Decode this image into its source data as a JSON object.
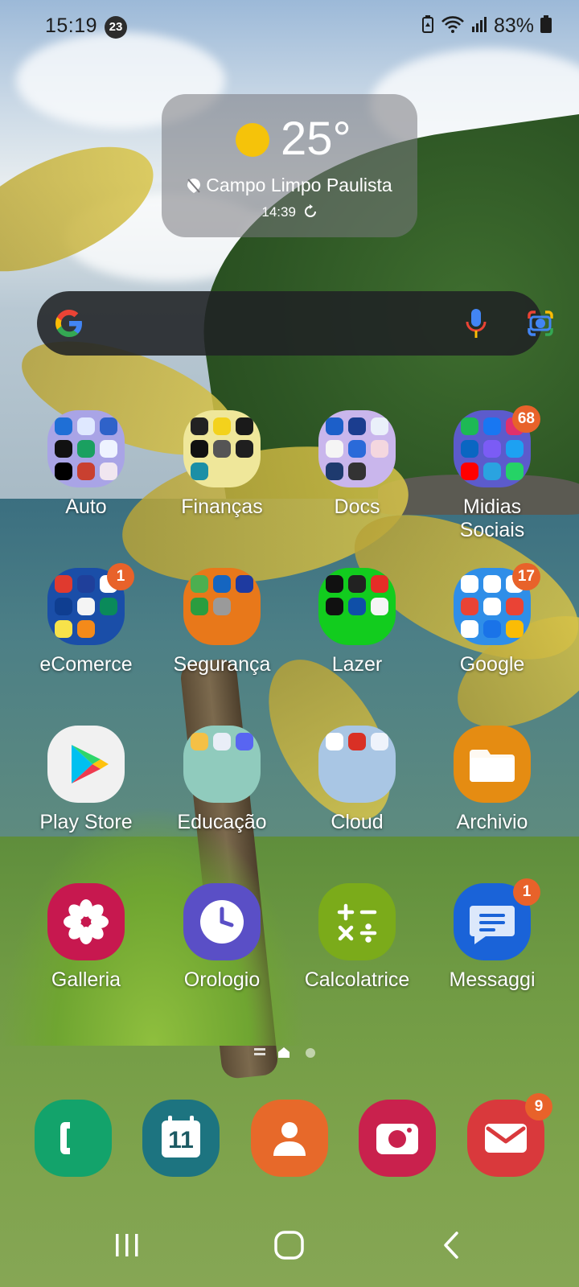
{
  "status_bar": {
    "time": "15:19",
    "notification_count": "23",
    "battery_percent": "83%",
    "icons": [
      "recycle-battery-icon",
      "wifi-icon",
      "signal-icon",
      "battery-icon"
    ]
  },
  "weather": {
    "temperature": "25°",
    "location": "Campo Limpo Paulista",
    "updated_time": "14:39",
    "condition_icon": "sun-icon"
  },
  "search": {
    "icons": [
      "google-logo",
      "mic-icon",
      "lens-icon"
    ]
  },
  "apps": [
    {
      "label": "Auto",
      "kind": "folder",
      "badge": ""
    },
    {
      "label": "Finanças",
      "kind": "folder",
      "badge": ""
    },
    {
      "label": "Docs",
      "kind": "folder",
      "badge": ""
    },
    {
      "label": "Midias\nSociais",
      "kind": "folder",
      "badge": "68"
    },
    {
      "label": "eComerce",
      "kind": "folder",
      "badge": "1"
    },
    {
      "label": "Segurança",
      "kind": "folder",
      "badge": ""
    },
    {
      "label": "Lazer",
      "kind": "folder",
      "badge": ""
    },
    {
      "label": "Google",
      "kind": "folder",
      "badge": "17"
    },
    {
      "label": "Play Store",
      "kind": "app",
      "badge": ""
    },
    {
      "label": "Educação",
      "kind": "folder",
      "badge": ""
    },
    {
      "label": "Cloud",
      "kind": "folder",
      "badge": ""
    },
    {
      "label": "Archivio",
      "kind": "app",
      "badge": ""
    },
    {
      "label": "Galleria",
      "kind": "app",
      "badge": ""
    },
    {
      "label": "Orologio",
      "kind": "app",
      "badge": ""
    },
    {
      "label": "Calcolatrice",
      "kind": "app",
      "badge": ""
    },
    {
      "label": "Messaggi",
      "kind": "app",
      "badge": "1"
    }
  ],
  "dock": {
    "calendar_day": "11",
    "email_badge": "9",
    "icons": [
      "phone-icon",
      "calendar-icon",
      "contacts-icon",
      "camera-icon",
      "email-icon"
    ]
  },
  "colors": {
    "badge": "#e8622a",
    "phone": "#13a36b",
    "calendar": "#1d7480",
    "contacts": "#e7692a",
    "camera": "#c9214d",
    "email": "#d9393c"
  }
}
